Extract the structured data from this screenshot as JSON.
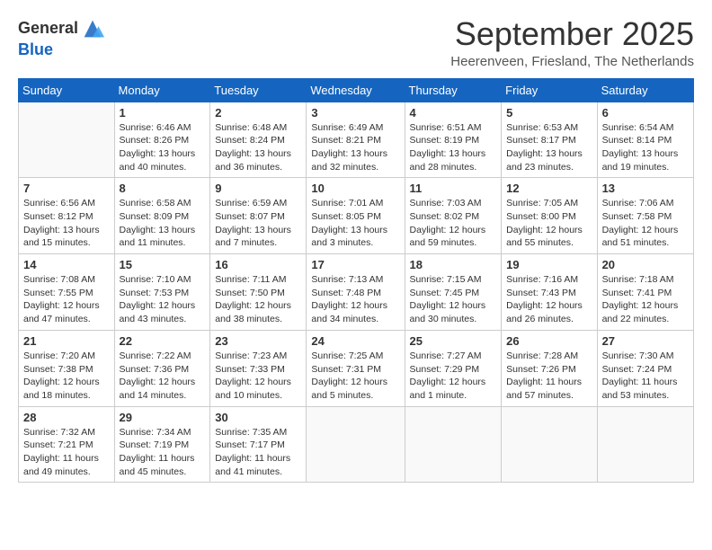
{
  "header": {
    "logo_general": "General",
    "logo_blue": "Blue",
    "month_title": "September 2025",
    "location": "Heerenveen, Friesland, The Netherlands"
  },
  "days_of_week": [
    "Sunday",
    "Monday",
    "Tuesday",
    "Wednesday",
    "Thursday",
    "Friday",
    "Saturday"
  ],
  "weeks": [
    [
      {
        "date": "",
        "info": ""
      },
      {
        "date": "1",
        "info": "Sunrise: 6:46 AM\nSunset: 8:26 PM\nDaylight: 13 hours\nand 40 minutes."
      },
      {
        "date": "2",
        "info": "Sunrise: 6:48 AM\nSunset: 8:24 PM\nDaylight: 13 hours\nand 36 minutes."
      },
      {
        "date": "3",
        "info": "Sunrise: 6:49 AM\nSunset: 8:21 PM\nDaylight: 13 hours\nand 32 minutes."
      },
      {
        "date": "4",
        "info": "Sunrise: 6:51 AM\nSunset: 8:19 PM\nDaylight: 13 hours\nand 28 minutes."
      },
      {
        "date": "5",
        "info": "Sunrise: 6:53 AM\nSunset: 8:17 PM\nDaylight: 13 hours\nand 23 minutes."
      },
      {
        "date": "6",
        "info": "Sunrise: 6:54 AM\nSunset: 8:14 PM\nDaylight: 13 hours\nand 19 minutes."
      }
    ],
    [
      {
        "date": "7",
        "info": "Sunrise: 6:56 AM\nSunset: 8:12 PM\nDaylight: 13 hours\nand 15 minutes."
      },
      {
        "date": "8",
        "info": "Sunrise: 6:58 AM\nSunset: 8:09 PM\nDaylight: 13 hours\nand 11 minutes."
      },
      {
        "date": "9",
        "info": "Sunrise: 6:59 AM\nSunset: 8:07 PM\nDaylight: 13 hours\nand 7 minutes."
      },
      {
        "date": "10",
        "info": "Sunrise: 7:01 AM\nSunset: 8:05 PM\nDaylight: 13 hours\nand 3 minutes."
      },
      {
        "date": "11",
        "info": "Sunrise: 7:03 AM\nSunset: 8:02 PM\nDaylight: 12 hours\nand 59 minutes."
      },
      {
        "date": "12",
        "info": "Sunrise: 7:05 AM\nSunset: 8:00 PM\nDaylight: 12 hours\nand 55 minutes."
      },
      {
        "date": "13",
        "info": "Sunrise: 7:06 AM\nSunset: 7:58 PM\nDaylight: 12 hours\nand 51 minutes."
      }
    ],
    [
      {
        "date": "14",
        "info": "Sunrise: 7:08 AM\nSunset: 7:55 PM\nDaylight: 12 hours\nand 47 minutes."
      },
      {
        "date": "15",
        "info": "Sunrise: 7:10 AM\nSunset: 7:53 PM\nDaylight: 12 hours\nand 43 minutes."
      },
      {
        "date": "16",
        "info": "Sunrise: 7:11 AM\nSunset: 7:50 PM\nDaylight: 12 hours\nand 38 minutes."
      },
      {
        "date": "17",
        "info": "Sunrise: 7:13 AM\nSunset: 7:48 PM\nDaylight: 12 hours\nand 34 minutes."
      },
      {
        "date": "18",
        "info": "Sunrise: 7:15 AM\nSunset: 7:45 PM\nDaylight: 12 hours\nand 30 minutes."
      },
      {
        "date": "19",
        "info": "Sunrise: 7:16 AM\nSunset: 7:43 PM\nDaylight: 12 hours\nand 26 minutes."
      },
      {
        "date": "20",
        "info": "Sunrise: 7:18 AM\nSunset: 7:41 PM\nDaylight: 12 hours\nand 22 minutes."
      }
    ],
    [
      {
        "date": "21",
        "info": "Sunrise: 7:20 AM\nSunset: 7:38 PM\nDaylight: 12 hours\nand 18 minutes."
      },
      {
        "date": "22",
        "info": "Sunrise: 7:22 AM\nSunset: 7:36 PM\nDaylight: 12 hours\nand 14 minutes."
      },
      {
        "date": "23",
        "info": "Sunrise: 7:23 AM\nSunset: 7:33 PM\nDaylight: 12 hours\nand 10 minutes."
      },
      {
        "date": "24",
        "info": "Sunrise: 7:25 AM\nSunset: 7:31 PM\nDaylight: 12 hours\nand 5 minutes."
      },
      {
        "date": "25",
        "info": "Sunrise: 7:27 AM\nSunset: 7:29 PM\nDaylight: 12 hours\nand 1 minute."
      },
      {
        "date": "26",
        "info": "Sunrise: 7:28 AM\nSunset: 7:26 PM\nDaylight: 11 hours\nand 57 minutes."
      },
      {
        "date": "27",
        "info": "Sunrise: 7:30 AM\nSunset: 7:24 PM\nDaylight: 11 hours\nand 53 minutes."
      }
    ],
    [
      {
        "date": "28",
        "info": "Sunrise: 7:32 AM\nSunset: 7:21 PM\nDaylight: 11 hours\nand 49 minutes."
      },
      {
        "date": "29",
        "info": "Sunrise: 7:34 AM\nSunset: 7:19 PM\nDaylight: 11 hours\nand 45 minutes."
      },
      {
        "date": "30",
        "info": "Sunrise: 7:35 AM\nSunset: 7:17 PM\nDaylight: 11 hours\nand 41 minutes."
      },
      {
        "date": "",
        "info": ""
      },
      {
        "date": "",
        "info": ""
      },
      {
        "date": "",
        "info": ""
      },
      {
        "date": "",
        "info": ""
      }
    ]
  ]
}
